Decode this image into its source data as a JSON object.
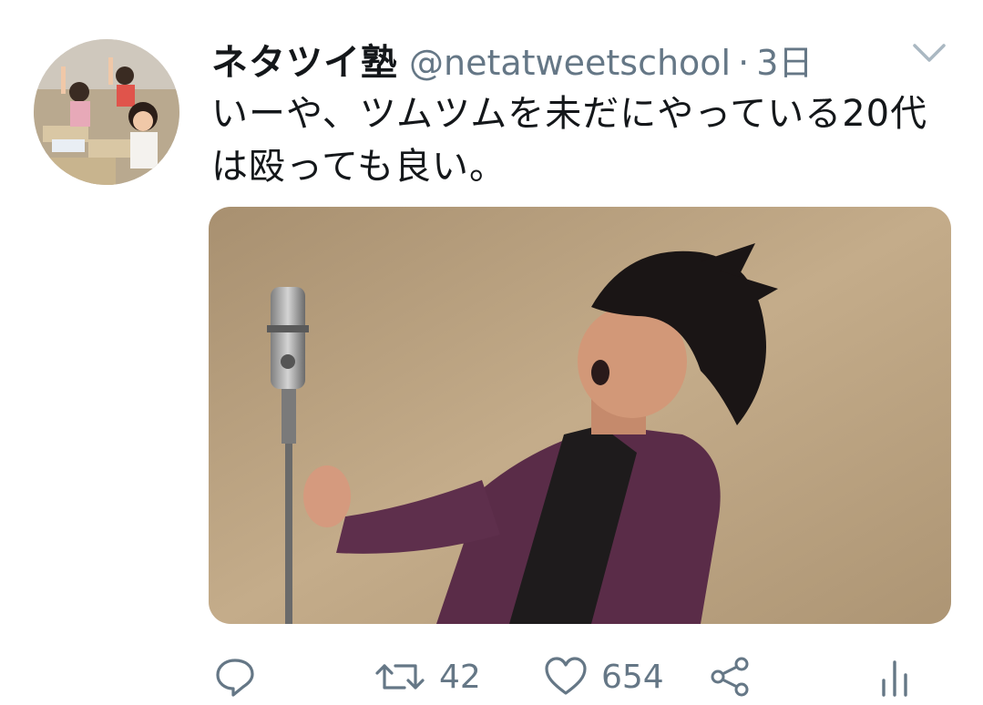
{
  "tweet": {
    "display_name": "ネタツイ塾",
    "handle": "@netatweetschool",
    "separator": "·",
    "time": "3日",
    "text": "いーや、ツムツムを未だにやっている20代は殴っても良い。"
  },
  "actions": {
    "retweet_count": "42",
    "like_count": "654"
  },
  "icons": {
    "reply": "reply-icon",
    "retweet": "retweet-icon",
    "like": "heart-icon",
    "share": "share-icon",
    "analytics": "analytics-icon",
    "menu": "chevron-down-icon"
  },
  "colors": {
    "text": "#14171a",
    "secondary": "#657786",
    "background": "#ffffff"
  }
}
